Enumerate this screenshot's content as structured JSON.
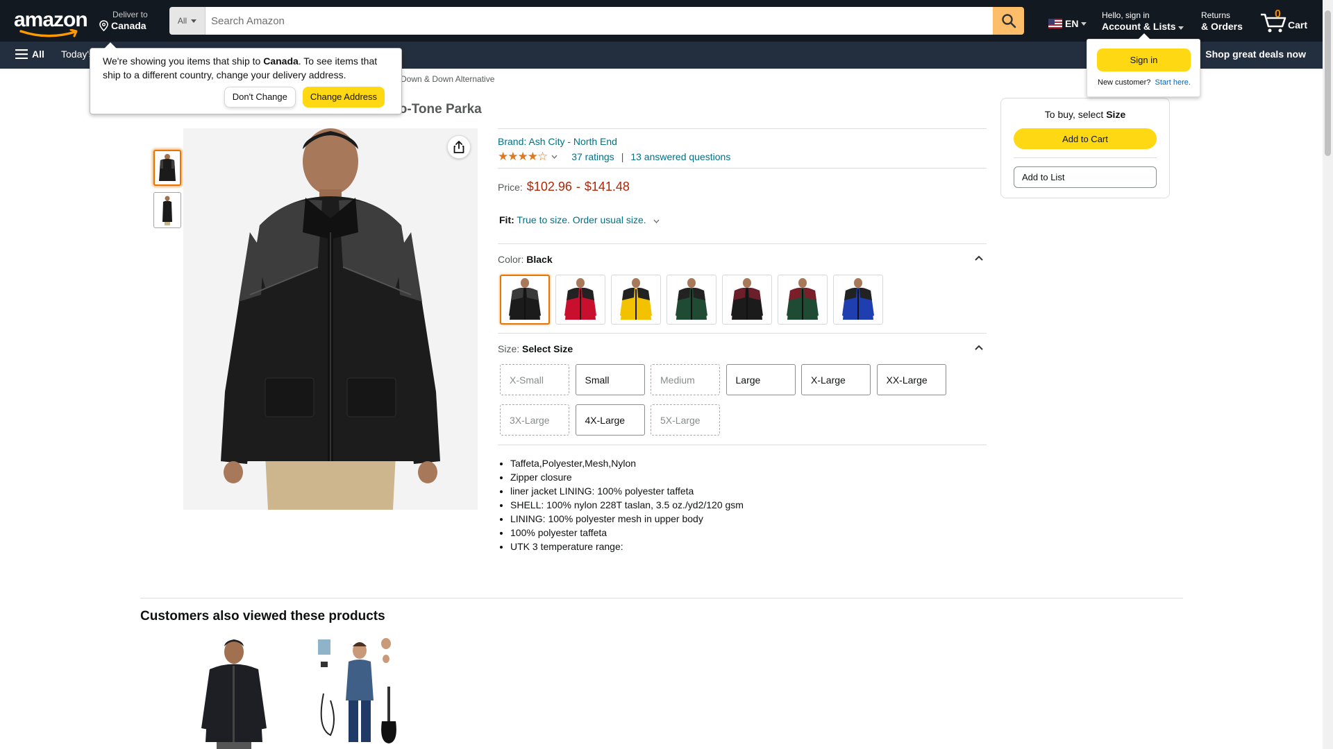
{
  "header": {
    "logo_text": "amazon",
    "deliver_line1": "Deliver to",
    "deliver_line2": "Canada",
    "search_category": "All",
    "search_placeholder": "Search Amazon",
    "language": "EN",
    "account_line1": "Hello, sign in",
    "account_line2": "Account & Lists",
    "returns_line1": "Returns",
    "returns_line2": "& Orders",
    "cart_count": "0",
    "cart_label": "Cart"
  },
  "subnav": {
    "all_label": "All",
    "today_label": "Today's",
    "deals_label": "Shop great deals now"
  },
  "delivery_popover": {
    "text_before": "We're showing you items that ship to ",
    "country": "Canada",
    "text_after": ". To see items that ship to a different country, change your delivery address.",
    "dont_change": "Don't Change",
    "change_address": "Change Address"
  },
  "signin_flyout": {
    "button": "Sign in",
    "new_customer": "New customer?",
    "start_here": "Start here."
  },
  "breadcrumb": "Down & Down Alternative",
  "product": {
    "title_visible": "wo-Tone Parka",
    "brand": "Brand: Ash City - North End",
    "stars": "★★★★☆",
    "rating_value": 4.5,
    "ratings": "37 ratings",
    "separator": "|",
    "questions": "13 answered questions",
    "price_label": "Price:",
    "price_low": "$102.96",
    "price_dash": "-",
    "price_high": "$141.48",
    "fit_label": "Fit:",
    "fit_value": "True to size. Order usual size.",
    "color_label": "Color:",
    "color_value": "Black",
    "colors": [
      {
        "name": "black",
        "body": "#1b1b1b",
        "accent": "#3a3a3a"
      },
      {
        "name": "red",
        "body": "#c8102e",
        "accent": "#222"
      },
      {
        "name": "yellow",
        "body": "#f2c200",
        "accent": "#222"
      },
      {
        "name": "forest",
        "body": "#1f4a34",
        "accent": "#222"
      },
      {
        "name": "black-burgundy",
        "body": "#1b1b1b",
        "accent": "#6b1f2a"
      },
      {
        "name": "forest-burgundy",
        "body": "#1f4a34",
        "accent": "#7a1f2a"
      },
      {
        "name": "royal",
        "body": "#1f3fb0",
        "accent": "#222"
      }
    ],
    "size_label": "Size:",
    "size_value": "Select Size",
    "sizes": [
      {
        "label": "X-Small",
        "available": false
      },
      {
        "label": "Small",
        "available": true
      },
      {
        "label": "Medium",
        "available": false
      },
      {
        "label": "Large",
        "available": true
      },
      {
        "label": "X-Large",
        "available": true
      },
      {
        "label": "XX-Large",
        "available": true
      },
      {
        "label": "3X-Large",
        "available": false
      },
      {
        "label": "4X-Large",
        "available": true
      },
      {
        "label": "5X-Large",
        "available": false
      }
    ],
    "bullets": [
      "Taffeta,Polyester,Mesh,Nylon",
      "Zipper closure",
      "liner jacket LINING: 100% polyester taffeta",
      "SHELL: 100% nylon 228T taslan, 3.5 oz./yd2/120 gsm",
      "LINING: 100% polyester mesh in upper body",
      "100% polyester taffeta",
      "UTK 3 temperature range:"
    ]
  },
  "buybox": {
    "prefix": "To buy, select ",
    "bold": "Size",
    "add_to_cart": "Add to Cart",
    "add_to_list": "Add to List"
  },
  "also_viewed": {
    "title": "Customers also viewed these products"
  },
  "colors": {
    "nav_dark": "#131921",
    "nav_secondary": "#232f3e",
    "accent_yellow": "#ffd814",
    "search_button": "#febd69",
    "link": "#007185",
    "price_red": "#b12704",
    "star_orange": "#de7921"
  }
}
